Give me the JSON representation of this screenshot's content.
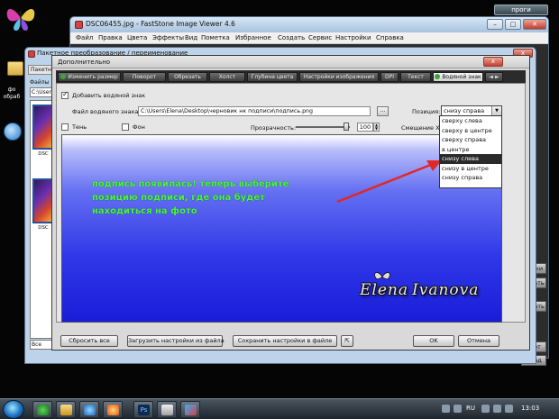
{
  "desktop": {
    "top_right_button": "проги",
    "folder_label": "фо\nобраб"
  },
  "fs": {
    "title": "DSC06455.jpg - FastStone Image Viewer 4.6",
    "menu": [
      "Файл",
      "Правка",
      "Цвета",
      "Эффекты",
      "Вид",
      "Пометка",
      "Избранное",
      "Создать",
      "Сервис",
      "Настройки",
      "Справка"
    ],
    "side_buttons": [
      "ровки",
      "ровать",
      "тирать",
      "тарт",
      "ыход"
    ]
  },
  "batch": {
    "title": "Пакетное преобразование / переименование",
    "tab": "Пакетное",
    "label": "Файлы",
    "path": "C:\\Users",
    "thumb_labels": [
      "DSC",
      "DSC"
    ],
    "all_folders": "Все форма"
  },
  "dialog": {
    "title": "Дополнительно",
    "close_label": "x",
    "tabs": [
      "Изменить размер",
      "Поворот",
      "Обрезать",
      "Холст",
      "Глубина цвета",
      "Настройки изображения",
      "DPI",
      "Текст",
      "Водяной знак"
    ],
    "tab_nav": "◄ ►",
    "add_watermark_label": "Добавить водяной знак",
    "add_watermark_checked": true,
    "file_label": "Файл водяного знака:",
    "file_path": "C:\\Users\\Elena\\Desktop\\черновик нк подписи\\подпись.png",
    "browse_label": "...",
    "position_label": "Позиция:",
    "position_value": "снизу справа",
    "shadow_label": "Тень",
    "shadow_checked": false,
    "background_label": "Фон",
    "background_checked": false,
    "opacity_label": "Прозрачность:",
    "opacity_value": "100",
    "offset_label": "Смещение X/Y:",
    "position_options": [
      "сверху слева",
      "сверху в центре",
      "сверху справа",
      "в центре",
      "снизу слева",
      "снизу в центре",
      "снизу справа"
    ],
    "position_selected_index": 4,
    "note": "подпись появилась! теперь выберите позицию подписи, где она будет находиться на фото",
    "signature_first": "Elena",
    "signature_last": "Ivanova",
    "buttons": {
      "reset": "Сбросить все",
      "load": "Загрузить настройки из файла",
      "save": "Сохранить настройки в файле",
      "ok": "OK",
      "cancel": "Отмена"
    }
  },
  "taskbar": {
    "lang": "RU",
    "clock": "13:03"
  },
  "colors": {
    "note_green": "#4cf04c",
    "arrow_red": "#e02828",
    "preview_blue": "#2f38e8"
  }
}
